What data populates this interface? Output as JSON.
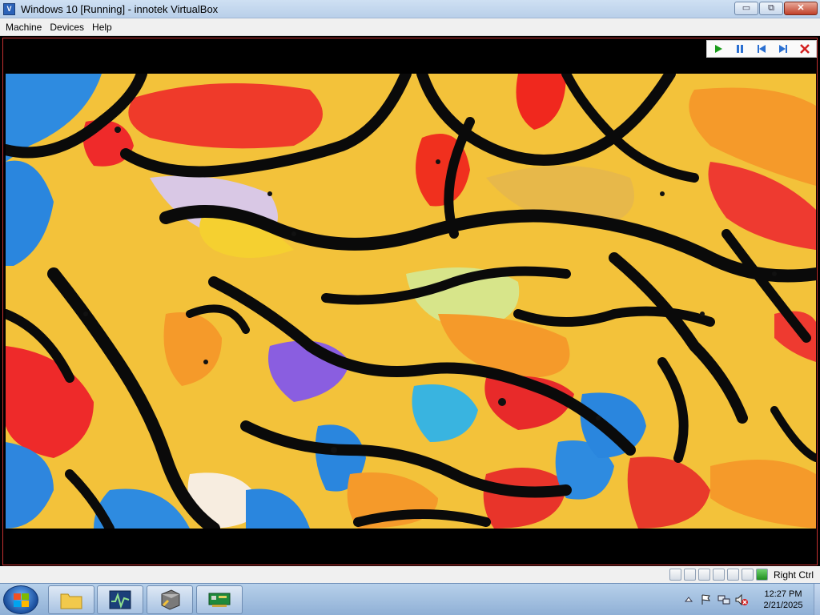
{
  "window": {
    "title": "Windows 10 [Running] - innotek VirtualBox",
    "min_label": "▭",
    "max_label": "⧉",
    "close_label": "✕"
  },
  "menu": [
    "Machine",
    "Devices",
    "Help"
  ],
  "media_controls": [
    {
      "name": "play-icon",
      "glyph": "▶",
      "color": "#1a9c1a"
    },
    {
      "name": "pause-icon",
      "glyph": "❚❚",
      "color": "#2a6fd1"
    },
    {
      "name": "skip-back-icon",
      "glyph": "⏮",
      "color": "#2a6fd1"
    },
    {
      "name": "skip-forward-icon",
      "glyph": "⏭",
      "color": "#2a6fd1"
    },
    {
      "name": "close-icon",
      "glyph": "✕",
      "color": "#d32020"
    }
  ],
  "status": {
    "host_key": "Right Ctrl"
  },
  "taskbar": {
    "clock_time": "12:27 PM",
    "clock_date": "2/21/2025"
  },
  "colors": {
    "vm_border": "#c43030",
    "accent_blue": "#2a6fd1"
  }
}
